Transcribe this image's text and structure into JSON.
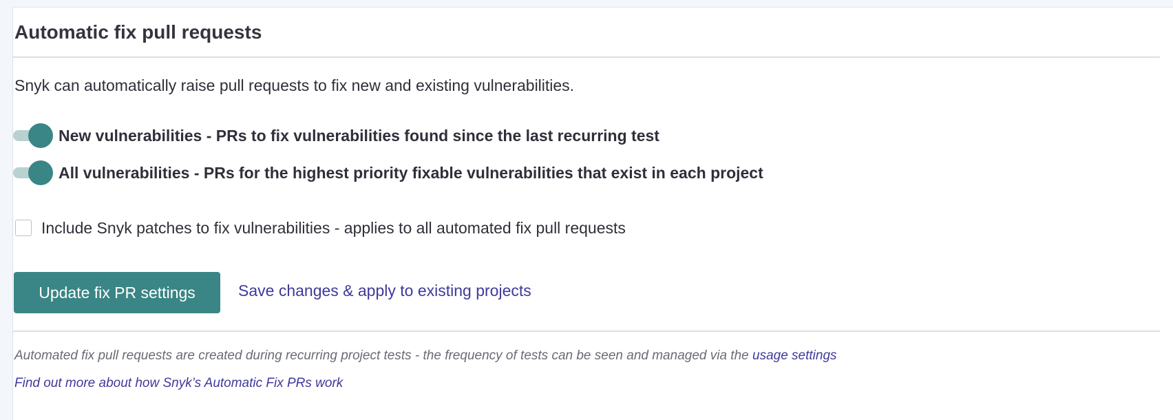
{
  "section": {
    "title": "Automatic fix pull requests",
    "description": "Snyk can automatically raise pull requests to fix new and existing vulnerabilities."
  },
  "toggles": [
    {
      "label": "New vulnerabilities - PRs to fix vulnerabilities found since the last recurring test",
      "enabled": true
    },
    {
      "label": "All vulnerabilities - PRs for the highest priority fixable vulnerabilities that exist in each project",
      "enabled": true
    }
  ],
  "patches_checkbox": {
    "label": "Include Snyk patches to fix vulnerabilities - applies to all automated fix pull requests",
    "checked": false
  },
  "actions": {
    "update_button": "Update fix PR settings",
    "save_apply_link": "Save changes & apply to existing projects"
  },
  "footer": {
    "note": "Automated fix pull requests are created during recurring project tests - the frequency of tests can be seen and managed via the ",
    "usage_link": "usage settings",
    "learn_more_link": "Find out more about how Snyk’s Automatic Fix PRs work"
  },
  "colors": {
    "accent": "#3a8585",
    "link": "#40399a",
    "toggle_track": "#b9d1d1"
  }
}
